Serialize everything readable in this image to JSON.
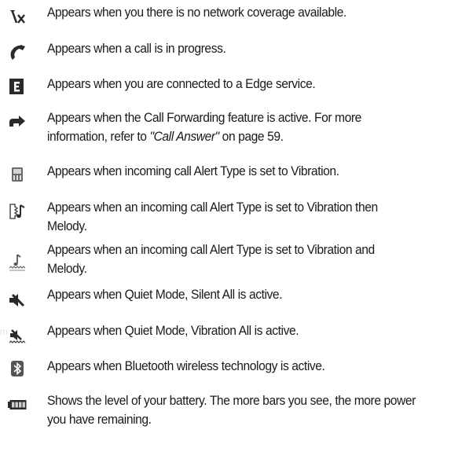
{
  "icon_rows": [
    {
      "icon": "no-network-icon",
      "text": "Appears when you there is no network coverage available."
    },
    {
      "icon": "call-in-progress-icon",
      "text": "Appears when a call is in progress."
    },
    {
      "icon": "edge-service-icon",
      "text": "Appears when you are connected to a Edge service."
    },
    {
      "icon": "call-forwarding-icon",
      "text_before": "Appears when the Call Forwarding feature is active. For more information, refer to ",
      "link_text": "\"Call Answer\"",
      "text_after": " on page 59."
    },
    {
      "icon": "vibration-icon",
      "text": "Appears when incoming call Alert Type is set to Vibration."
    },
    {
      "icon": "vibration-then-melody-icon",
      "text": "Appears when an incoming call Alert Type is set to Vibration then Melody."
    },
    {
      "icon": "vibration-and-melody-icon",
      "text": "Appears when an incoming call Alert Type is set to Vibration and Melody."
    },
    {
      "icon": "silent-all-icon",
      "text": "Appears when Quiet Mode, Silent All is active."
    },
    {
      "icon": "vibration-all-icon",
      "text": "Appears when Quiet Mode, Vibration All is active."
    },
    {
      "icon": "bluetooth-icon",
      "text": "Appears when Bluetooth wireless technology is active."
    },
    {
      "icon": "battery-icon",
      "text": "Shows the level of your battery. The more bars you see, the more power you have remaining."
    }
  ],
  "watermark": "m",
  "colors": {
    "text": "#1a1a1a",
    "icon": "#2a2a2a",
    "watermark": "#e2e2e2"
  }
}
